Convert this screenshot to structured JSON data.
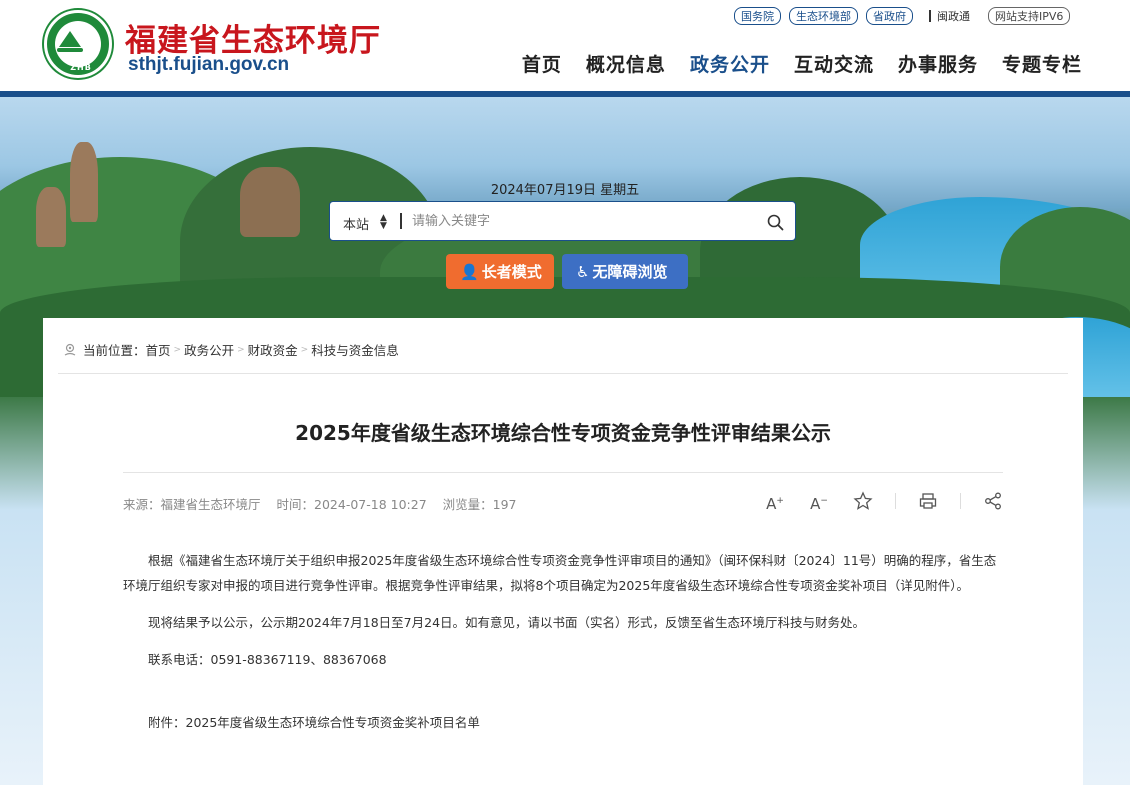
{
  "header": {
    "site_name": "福建省生态环境厅",
    "site_domain": "sthjt.fujian.gov.cn",
    "logo_text": "ZHB",
    "top_links": [
      "国务院",
      "生态环境部",
      "省政府"
    ],
    "read_gov": "闽政通",
    "ipv6": "网站支持IPV6",
    "nav": [
      "首页",
      "概况信息",
      "政务公开",
      "互动交流",
      "办事服务",
      "专题专栏"
    ],
    "active_nav": "政务公开"
  },
  "banner": {
    "date": "2024年07月19日  星期五",
    "search_scope": "本站",
    "search_placeholder": "请输入关键字",
    "elder_mode": "长者模式",
    "accessible": "无障碍浏览"
  },
  "breadcrumb": {
    "label": "当前位置：",
    "items": [
      "首页",
      "政务公开",
      "财政资金",
      "科技与资金信息"
    ]
  },
  "article": {
    "title": "2025年度省级生态环境综合性专项资金竞争性评审结果公示",
    "source": "来源：福建省生态环境厅",
    "time": "时间：2024-07-18 10:27",
    "views": "浏览量：197",
    "tools": [
      "font-increase-icon",
      "font-decrease-icon",
      "favorite-star-icon",
      "print-icon",
      "share-icon"
    ],
    "paragraphs": [
      "根据《福建省生态环境厅关于组织申报2025年度省级生态环境综合性专项资金竞争性评审项目的通知》（闽环保科财〔2024〕11号）明确的程序，省生态环境厅组织专家对申报的项目进行竞争性评审。根据竞争性评审结果，拟将8个项目确定为2025年度省级生态环境综合性专项资金奖补项目（详见附件）。",
      "现将结果予以公示，公示期2024年7月18日至7月24日。如有意见，请以书面（实名）形式，反馈至省生态环境厅科技与财务处。",
      "联系电话：0591-88367119、88367068",
      "附件：2025年度省级生态环境综合性专项资金奖补项目名单"
    ]
  },
  "colors": {
    "brand_red": "#c8161d",
    "brand_blue": "#1a4f8b",
    "elder_orange": "#f06c2f",
    "access_blue": "#3d6fc4"
  }
}
